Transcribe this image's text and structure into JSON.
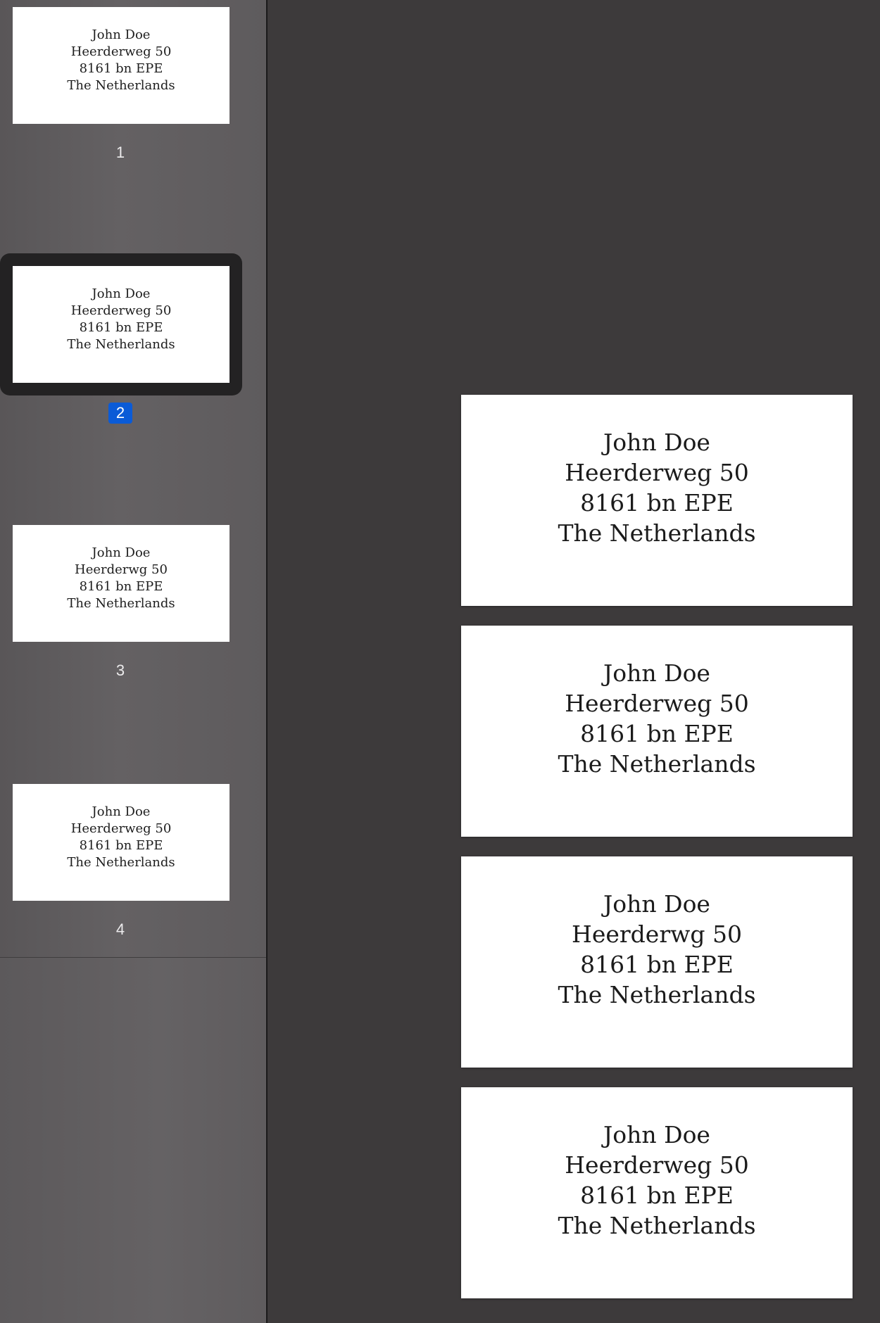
{
  "sidebar": {
    "thumbnails": [
      {
        "page_number": "1",
        "lines": [
          "John Doe",
          "Heerderweg 50",
          "8161 bn EPE",
          "The Netherlands"
        ]
      },
      {
        "page_number": "2",
        "lines": [
          "John Doe",
          "Heerderweg 50",
          "8161 bn EPE",
          "The Netherlands"
        ]
      },
      {
        "page_number": "3",
        "lines": [
          "John Doe",
          "Heerderwg 50",
          "8161 bn EPE",
          "The Netherlands"
        ]
      },
      {
        "page_number": "4",
        "lines": [
          "John Doe",
          "Heerderweg 50",
          "8161 bn EPE",
          "The Netherlands"
        ]
      }
    ],
    "selected_page": "2",
    "selection_color": "#0a5bd7"
  },
  "document": {
    "pages": [
      {
        "lines": [
          "John Doe",
          "Heerderweg 50",
          "8161 bn EPE",
          "The Netherlands"
        ]
      },
      {
        "lines": [
          "John Doe",
          "Heerderweg 50",
          "8161 bn EPE",
          "The Netherlands"
        ]
      },
      {
        "lines": [
          "John Doe",
          "Heerderwg 50",
          "8161 bn EPE",
          "The Netherlands"
        ]
      },
      {
        "lines": [
          "John Doe",
          "Heerderweg 50",
          "8161 bn EPE",
          "The Netherlands"
        ]
      }
    ]
  }
}
